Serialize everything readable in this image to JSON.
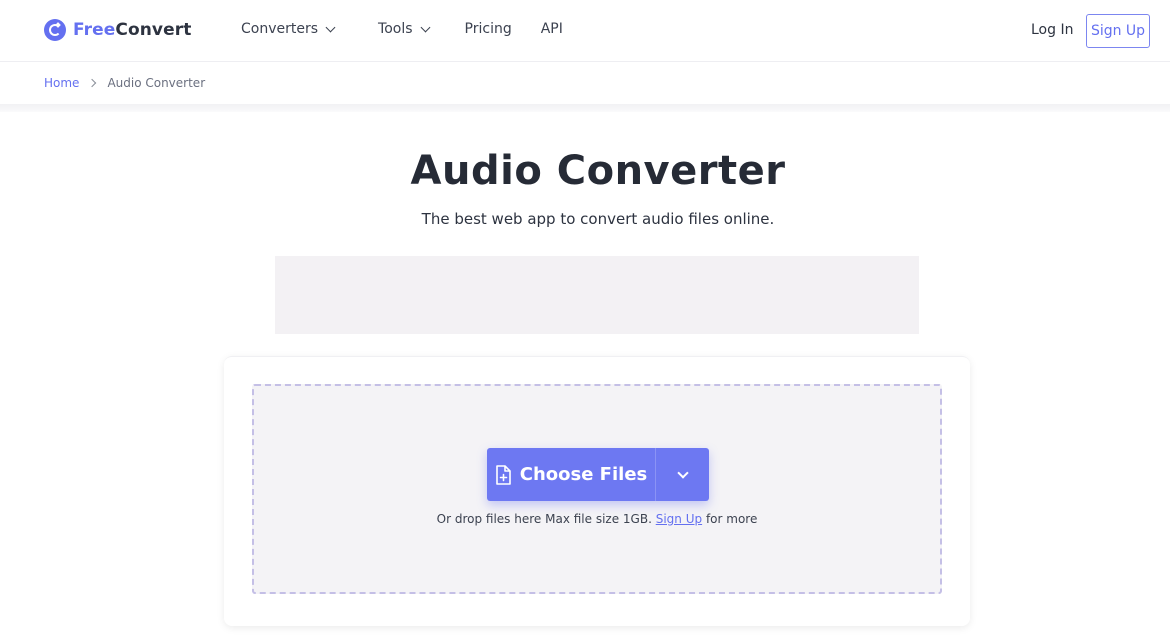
{
  "header": {
    "logo_free": "Free",
    "logo_convert": "Convert",
    "nav": {
      "converters": "Converters",
      "tools": "Tools",
      "pricing": "Pricing",
      "api": "API"
    },
    "login": "Log In",
    "signup": "Sign Up"
  },
  "breadcrumb": {
    "home": "Home",
    "current": "Audio Converter"
  },
  "main": {
    "title": "Audio Converter",
    "subtitle": "The best web app to convert audio files online."
  },
  "upload": {
    "choose_label": "Choose Files",
    "drop_text": "Or drop files here Max file size 1GB.",
    "signup_link": "Sign Up",
    "drop_suffix": "for more"
  },
  "colors": {
    "accent": "#6470f0",
    "button": "#6d78f2",
    "dropzone_border": "#c4bfe6",
    "dropzone_bg": "#f4f3f6"
  },
  "icons": {
    "logo": "freeconvert-logo-icon",
    "file": "file-plus-icon",
    "chevron": "chevron-down-icon"
  }
}
